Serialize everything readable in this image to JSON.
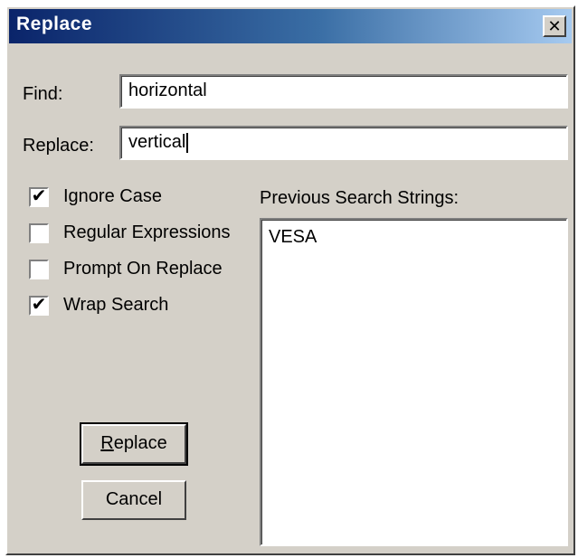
{
  "window": {
    "title": "Replace",
    "close_glyph": "✕"
  },
  "find": {
    "label": "Find:",
    "value": "horizontal"
  },
  "replace": {
    "label": "Replace:",
    "value": "vertical"
  },
  "options": [
    {
      "label": "Ignore Case",
      "checked": true
    },
    {
      "label": "Regular Expressions",
      "checked": false
    },
    {
      "label": "Prompt On Replace",
      "checked": false
    },
    {
      "label": "Wrap Search",
      "checked": true
    }
  ],
  "previous": {
    "label": "Previous Search Strings:",
    "items": [
      "VESA"
    ]
  },
  "buttons": {
    "replace_label": "Replace",
    "cancel_label": "Cancel"
  },
  "colors": {
    "titlebar_start": "#0a246a",
    "titlebar_end": "#a6caf0",
    "dialog_bg": "#d4d0c8"
  }
}
